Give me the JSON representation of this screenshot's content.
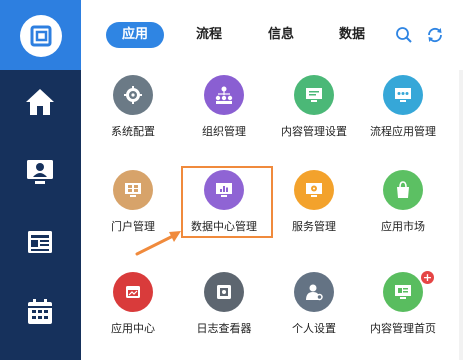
{
  "header": {
    "tabs": [
      {
        "label": "应用",
        "active": true
      },
      {
        "label": "流程",
        "active": false
      },
      {
        "label": "信息",
        "active": false
      },
      {
        "label": "数据",
        "active": false
      }
    ],
    "icons": [
      "search-icon",
      "refresh-icon"
    ]
  },
  "sidebar": {
    "items": [
      {
        "icon": "logo-icon"
      },
      {
        "icon": "home-icon"
      },
      {
        "icon": "monitor-user-icon"
      },
      {
        "icon": "news-icon"
      },
      {
        "icon": "calendar-icon"
      }
    ]
  },
  "apps": [
    {
      "label": "系统配置",
      "icon": "gear-icon",
      "color": "#6b7a86"
    },
    {
      "label": "组织管理",
      "icon": "org-icon",
      "color": "#8a5fd2"
    },
    {
      "label": "内容管理设置",
      "icon": "content-settings-icon",
      "color": "#4bb877"
    },
    {
      "label": "流程应用管理",
      "icon": "flow-app-icon",
      "color": "#36a7d8"
    },
    {
      "label": "门户管理",
      "icon": "portal-icon",
      "color": "#d7a36a"
    },
    {
      "label": "数据中心管理",
      "icon": "data-center-icon",
      "color": "#8f64d4"
    },
    {
      "label": "服务管理",
      "icon": "service-icon",
      "color": "#f3a22c"
    },
    {
      "label": "应用市场",
      "icon": "shopping-bag-icon",
      "color": "#5cc063"
    },
    {
      "label": "应用中心",
      "icon": "app-center-icon",
      "color": "#d93b3b"
    },
    {
      "label": "日志查看器",
      "icon": "log-viewer-icon",
      "color": "#5d6670"
    },
    {
      "label": "个人设置",
      "icon": "user-settings-icon",
      "color": "#647384"
    },
    {
      "label": "内容管理首页",
      "icon": "content-home-icon",
      "color": "#59bd5f"
    }
  ],
  "highlight": {
    "app": "数据中心管理",
    "color": "#f08a3c"
  },
  "badge": {
    "text": "+"
  }
}
